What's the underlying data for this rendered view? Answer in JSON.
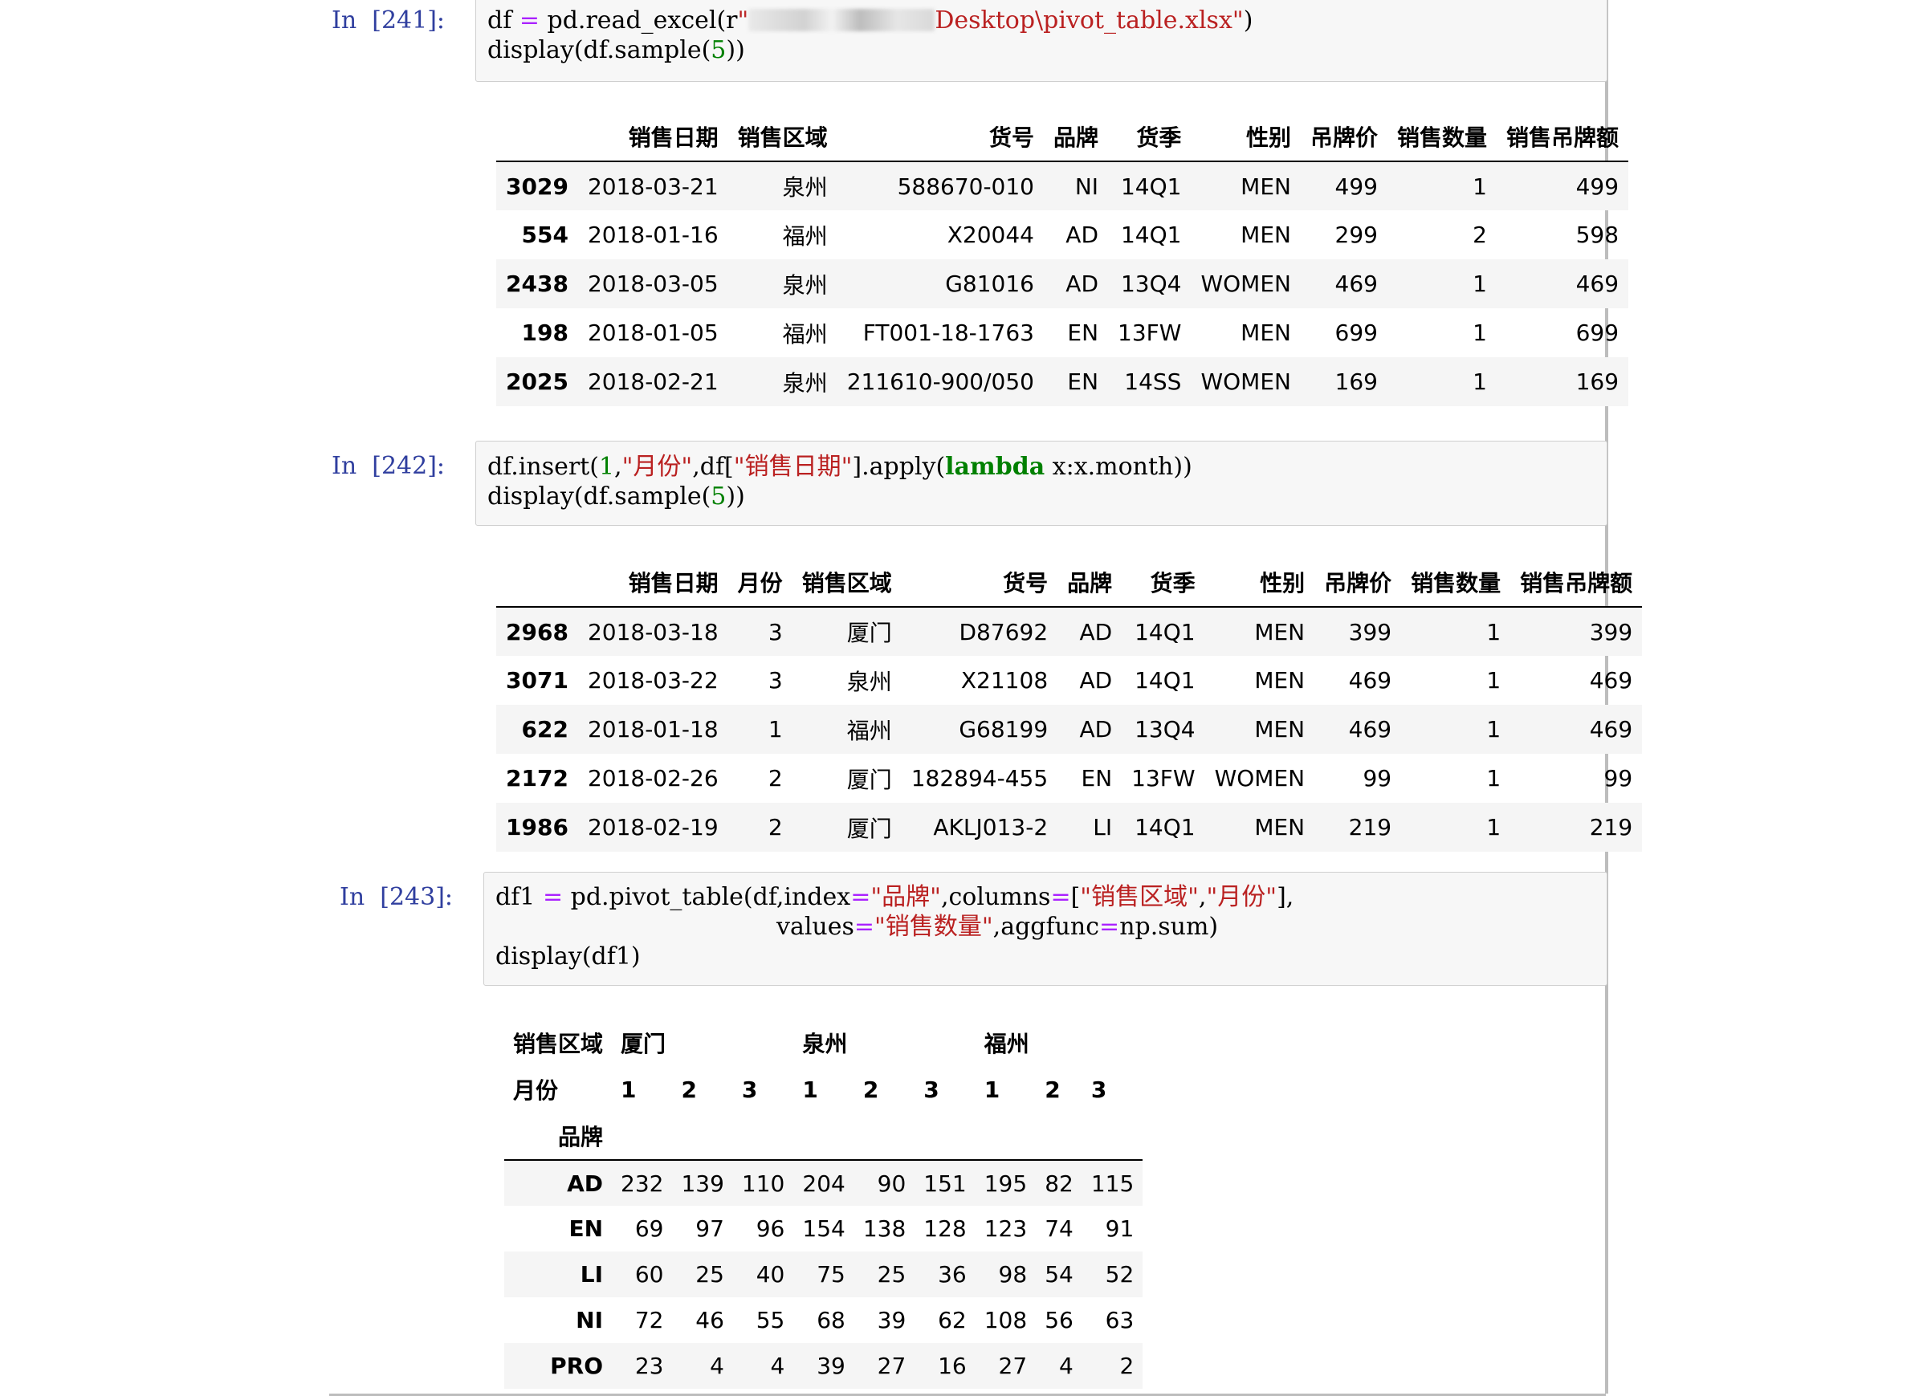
{
  "cells": [
    {
      "prompt": "In  [241]:",
      "code": {
        "line1_a": "df ",
        "line1_eq": "=",
        "line1_b": " pd.read_excel(r",
        "line1_str_open": "\"",
        "line1_str_end": "Desktop\\pivot_table.xlsx\"",
        "line1_c": ")",
        "line2_a": "display",
        "line2_b": "(df.sample(",
        "line2_num": "5",
        "line2_c": "))"
      },
      "table": {
        "columns": [
          "",
          "销售日期",
          "销售区域",
          "货号",
          "品牌",
          "货季",
          "性别",
          "吊牌价",
          "销售数量",
          "销售吊牌额"
        ],
        "rows": [
          [
            "3029",
            "2018-03-21",
            "泉州",
            "588670-010",
            "NI",
            "14Q1",
            "MEN",
            "499",
            "1",
            "499"
          ],
          [
            "554",
            "2018-01-16",
            "福州",
            "X20044",
            "AD",
            "14Q1",
            "MEN",
            "299",
            "2",
            "598"
          ],
          [
            "2438",
            "2018-03-05",
            "泉州",
            "G81016",
            "AD",
            "13Q4",
            "WOMEN",
            "469",
            "1",
            "469"
          ],
          [
            "198",
            "2018-01-05",
            "福州",
            "FT001-18-1763",
            "EN",
            "13FW",
            "MEN",
            "699",
            "1",
            "699"
          ],
          [
            "2025",
            "2018-02-21",
            "泉州",
            "211610-900/050",
            "EN",
            "14SS",
            "WOMEN",
            "169",
            "1",
            "169"
          ]
        ]
      }
    },
    {
      "prompt": "In  [242]:",
      "code": {
        "line1_a": "df.insert(",
        "line1_num": "1",
        "line1_comma": ",",
        "line1_s1": "\"月份\"",
        "line1_b": ",df[",
        "line1_s2": "\"销售日期\"",
        "line1_c": "].apply(",
        "line1_kw": "lambda",
        "line1_d": " x:x.month))",
        "line2_a": "display",
        "line2_b": "(df.sample(",
        "line2_num": "5",
        "line2_c": "))"
      },
      "table": {
        "columns": [
          "",
          "销售日期",
          "月份",
          "销售区域",
          "货号",
          "品牌",
          "货季",
          "性别",
          "吊牌价",
          "销售数量",
          "销售吊牌额"
        ],
        "rows": [
          [
            "2968",
            "2018-03-18",
            "3",
            "厦门",
            "D87692",
            "AD",
            "14Q1",
            "MEN",
            "399",
            "1",
            "399"
          ],
          [
            "3071",
            "2018-03-22",
            "3",
            "泉州",
            "X21108",
            "AD",
            "14Q1",
            "MEN",
            "469",
            "1",
            "469"
          ],
          [
            "622",
            "2018-01-18",
            "1",
            "福州",
            "G68199",
            "AD",
            "13Q4",
            "MEN",
            "469",
            "1",
            "469"
          ],
          [
            "2172",
            "2018-02-26",
            "2",
            "厦门",
            "182894-455",
            "EN",
            "13FW",
            "WOMEN",
            "99",
            "1",
            "99"
          ],
          [
            "1986",
            "2018-02-19",
            "2",
            "厦门",
            "AKLJ013-2",
            "LI",
            "14Q1",
            "MEN",
            "219",
            "1",
            "219"
          ]
        ]
      }
    },
    {
      "prompt": "In  [243]:",
      "code": {
        "line1_a": "df1 ",
        "line1_eq": "=",
        "line1_b": " pd.pivot_table(df,index",
        "line1_eq2": "=",
        "line1_s1": "\"品牌\"",
        "line1_c": ",columns",
        "line1_eq3": "=",
        "line1_d": "[",
        "line1_s2": "\"销售区域\"",
        "line1_e": ",",
        "line1_s3": "\"月份\"",
        "line1_f": "],",
        "line2_a": "values",
        "line2_eq": "=",
        "line2_s1": "\"销售数量\"",
        "line2_b": ",aggfunc",
        "line2_eq2": "=",
        "line2_c": "np.sum)",
        "line3": "display(df1)"
      },
      "pivot": {
        "region_label": "销售区域",
        "month_label": "月份",
        "index_label": "品牌",
        "regions": [
          "厦门",
          "泉州",
          "福州"
        ],
        "months": [
          "1",
          "2",
          "3",
          "1",
          "2",
          "3",
          "1",
          "2",
          "3"
        ],
        "rows": [
          [
            "AD",
            "232",
            "139",
            "110",
            "204",
            "90",
            "151",
            "195",
            "82",
            "115"
          ],
          [
            "EN",
            "69",
            "97",
            "96",
            "154",
            "138",
            "128",
            "123",
            "74",
            "91"
          ],
          [
            "LI",
            "60",
            "25",
            "40",
            "75",
            "25",
            "36",
            "98",
            "54",
            "52"
          ],
          [
            "NI",
            "72",
            "46",
            "55",
            "68",
            "39",
            "62",
            "108",
            "56",
            "63"
          ],
          [
            "PRO",
            "23",
            "4",
            "4",
            "39",
            "27",
            "16",
            "27",
            "4",
            "2"
          ]
        ]
      }
    }
  ]
}
